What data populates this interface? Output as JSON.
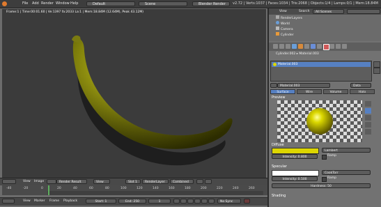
{
  "menu": {
    "file": "File",
    "add": "Add",
    "render": "Render",
    "window": "Window",
    "help": "Help"
  },
  "screen_layout": "Default",
  "scene": "Scene",
  "render_engine": "Blender Render",
  "stats": "v2.72 | Verts:1037 | Faces:1034 | Tris:2068 | Objects:1/4 | Lamps:0/1 | Mem:18.84M",
  "viewport": {
    "info": "Frame:1 | Time:00:01.60 | Ve:1397 fa:2033 La:1 | Mem:18.84M (12.64M), Peak 43.12M)"
  },
  "image_editor_header": {
    "view": "View",
    "image": "Image",
    "image_name": "Render Result",
    "view_field": "View",
    "slot": "Slot 1",
    "layer": "RenderLayer",
    "pass": "Combined"
  },
  "timeline": {
    "ticks": [
      "-40",
      "-20",
      "0",
      "20",
      "40",
      "60",
      "80",
      "100",
      "120",
      "140",
      "160",
      "180",
      "200",
      "220",
      "240",
      "260"
    ],
    "view": "View",
    "marker": "Marker",
    "frame": "Frame",
    "playback": "Playback",
    "start": "Start: 1",
    "end": "End: 250",
    "current": "1",
    "sync": "No Sync"
  },
  "outliner": {
    "view": "View",
    "search": "Search",
    "filter": "All Scenes",
    "items": [
      "RenderLayers",
      "World",
      "Camera",
      "Cylinder"
    ]
  },
  "properties": {
    "breadcrumb_object": "Cylinder.002",
    "breadcrumb_material": "Material.003",
    "slot": "Material.003",
    "material_name": "Material.003",
    "data": "Data",
    "tabs": [
      "Surface",
      "Wire",
      "Volume",
      "Halo"
    ],
    "preview": "Preview",
    "diffuse": "Diffuse",
    "diffuse_shader": "Lambert",
    "diffuse_intensity": "Intensity: 0.800",
    "ramp": "Ramp",
    "specular": "Specular",
    "specular_shader": "CookTorr",
    "specular_intensity": "Intensity: 0.500",
    "hardness": "Hardness: 50",
    "shading": "Shading"
  },
  "colors": {
    "diffuse": "#ddd600",
    "specular": "#ffffff",
    "accent": "#5680c2"
  }
}
